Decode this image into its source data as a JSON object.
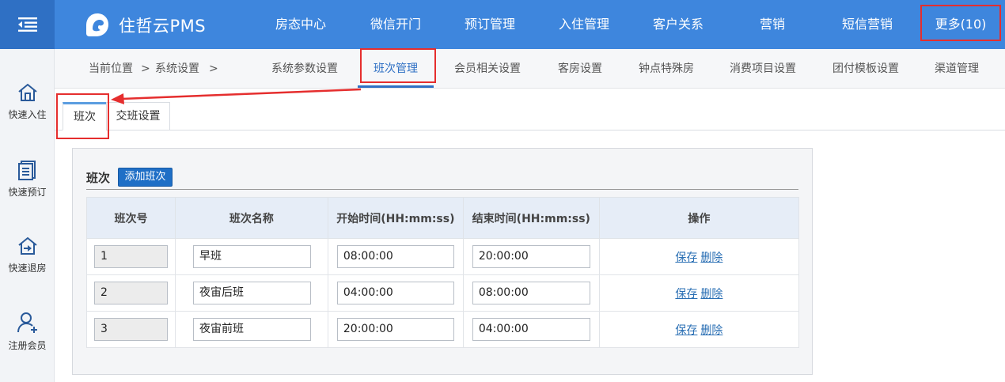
{
  "app": {
    "name": "住哲云PMS"
  },
  "nav": {
    "items": [
      {
        "label": "房态中心"
      },
      {
        "label": "微信开门"
      },
      {
        "label": "预订管理"
      },
      {
        "label": "入住管理"
      },
      {
        "label": "客户关系"
      },
      {
        "label": "营销"
      },
      {
        "label": "短信营销"
      },
      {
        "label": "更多(10)"
      }
    ]
  },
  "sidebar": {
    "items": [
      {
        "label": "快速入住",
        "icon": "home-icon"
      },
      {
        "label": "快速预订",
        "icon": "document-icon"
      },
      {
        "label": "快速退房",
        "icon": "checkout-icon"
      },
      {
        "label": "注册会员",
        "icon": "add-user-icon"
      }
    ]
  },
  "breadcrumb": {
    "prefix": "当前位置",
    "sep1": ">",
    "section": "系统设置",
    "sep2": ">"
  },
  "subtabs": [
    {
      "label": "系统参数设置"
    },
    {
      "label": "班次管理"
    },
    {
      "label": "会员相关设置"
    },
    {
      "label": "客房设置"
    },
    {
      "label": "钟点特殊房"
    },
    {
      "label": "消费项目设置"
    },
    {
      "label": "团付模板设置"
    },
    {
      "label": "渠道管理"
    }
  ],
  "inner_tabs": [
    {
      "label": "班次"
    },
    {
      "label": "交班设置"
    }
  ],
  "panel": {
    "title": "班次",
    "add_button": "添加班次",
    "columns": [
      "班次号",
      "班次名称",
      "开始时间(HH:mm:ss)",
      "结束时间(HH:mm:ss)",
      "操作"
    ],
    "rows": [
      {
        "id": "1",
        "name": "早班",
        "start": "08:00:00",
        "end": "20:00:00"
      },
      {
        "id": "2",
        "name": "夜宙后班",
        "start": "04:00:00",
        "end": "08:00:00"
      },
      {
        "id": "3",
        "name": "夜宙前班",
        "start": "20:00:00",
        "end": "04:00:00"
      }
    ],
    "save_label": "保存",
    "delete_label": "删除"
  },
  "colors": {
    "topbar": "#3e86dd",
    "highlight": "#e52e2e",
    "accent": "#2f70c4"
  }
}
